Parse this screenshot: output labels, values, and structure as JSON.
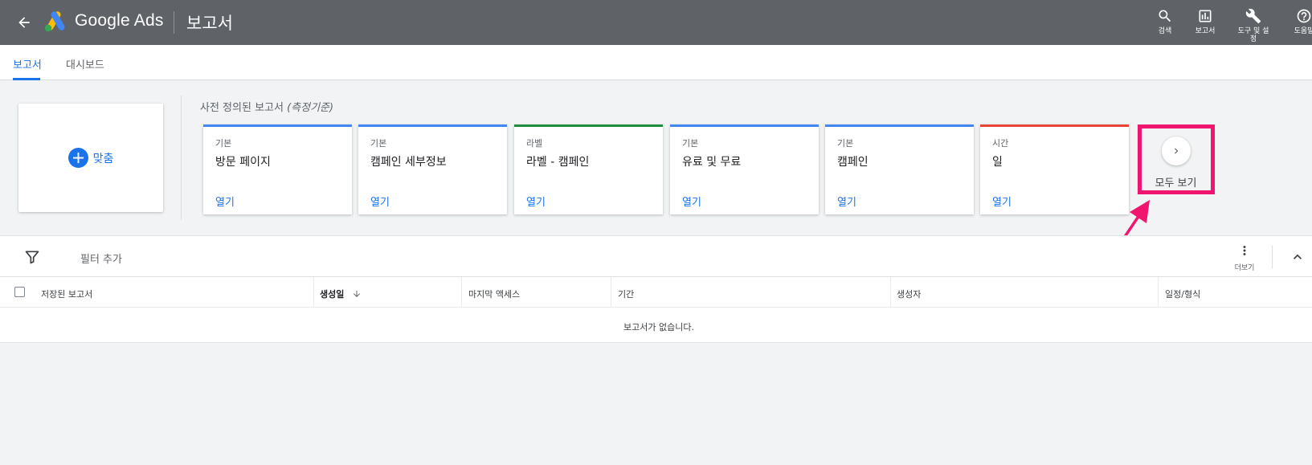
{
  "header": {
    "product": "Google Ads",
    "page_title": "보고서",
    "actions": [
      {
        "label": "검색",
        "icon": "search-icon"
      },
      {
        "label": "보고서",
        "icon": "reports-icon"
      },
      {
        "label": "도구 및 설정",
        "icon": "wrench-icon"
      },
      {
        "label": "도움말",
        "icon": "help-icon"
      }
    ]
  },
  "tabs": [
    {
      "label": "보고서",
      "active": true
    },
    {
      "label": "대시보드",
      "active": false
    }
  ],
  "custom": {
    "label": "맞춤"
  },
  "predefined": {
    "title_prefix": "사전 정의된 보고서 ",
    "title_italic": "(측정기준)",
    "cards": [
      {
        "category": "기본",
        "name": "방문 페이지",
        "open": "열기",
        "color": "#4285f4"
      },
      {
        "category": "기본",
        "name": "캠페인 세부정보",
        "open": "열기",
        "color": "#4285f4"
      },
      {
        "category": "라벨",
        "name": "라벨 - 캠페인",
        "open": "열기",
        "color": "#1e8e3e"
      },
      {
        "category": "기본",
        "name": "유료 및 무료",
        "open": "열기",
        "color": "#4285f4"
      },
      {
        "category": "기본",
        "name": "캠페인",
        "open": "열기",
        "color": "#4285f4"
      },
      {
        "category": "시간",
        "name": "일",
        "open": "열기",
        "color": "#ea4335"
      }
    ],
    "view_all": "모두 보기"
  },
  "filter": {
    "label": "필터 추가",
    "more_label": "더보기"
  },
  "table": {
    "columns": [
      "저장된 보고서",
      "생성일",
      "마지막 액세스",
      "기간",
      "생성자",
      "일정/형식"
    ],
    "empty": "보고서가 없습니다."
  },
  "colors": {
    "accent": "#1a73e8",
    "header_bg": "#5f6368",
    "highlight": "#f0166d"
  }
}
